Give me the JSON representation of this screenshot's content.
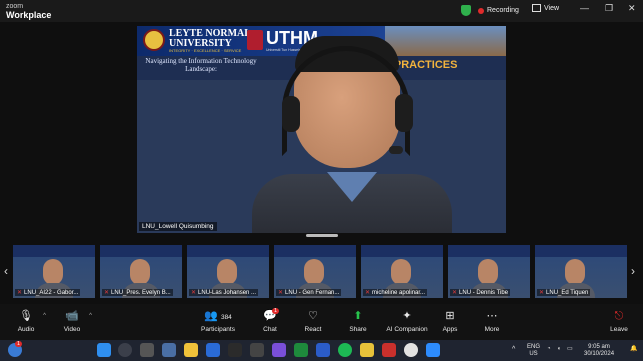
{
  "app": {
    "brand_top": "zoom",
    "brand_bottom": "Workplace"
  },
  "titlebar": {
    "recording_label": "Recording",
    "view_label": "View",
    "minimize": "—",
    "restore": "❐",
    "close": "✕"
  },
  "speaker": {
    "name": "LNU_Lowell Quisumbing",
    "banner": {
      "lnu_line1": "LEYTE NORMAL",
      "lnu_line2": "UNIVERSITY",
      "lnu_tagline": "INTEGRITY · EXCELLENCE · SERVICE",
      "uthm": "UTHM",
      "uthm_sub": "Universiti Tun Hussein Onn Malaysia",
      "title_left": "Navigating the Information Technology Landscape:",
      "title_right": "EMERG… AND PRACTICES"
    }
  },
  "participants_strip": [
    {
      "name": "LNU_AI22 - Gabor..."
    },
    {
      "name": "LNU_Pres. Evelyn B..."
    },
    {
      "name": "LNU-Las Johansen ..."
    },
    {
      "name": "LNU - Gen Fernan..."
    },
    {
      "name": "micheline apolinar..."
    },
    {
      "name": "LNU - Dennis Tibe"
    },
    {
      "name": "LNU_Ed Tiquen"
    }
  ],
  "toolbar": {
    "audio": "Audio",
    "video": "Video",
    "participants": "Participants",
    "participants_count": "384",
    "chat": "Chat",
    "chat_badge": "1",
    "react": "React",
    "share": "Share",
    "ai_companion": "AI Companion",
    "apps": "Apps",
    "more": "More",
    "leave": "Leave"
  },
  "taskbar": {
    "lang": "ENG",
    "region": "US",
    "time": "9:05 am",
    "date": "30/10/2024",
    "notif": "1"
  },
  "colors": {
    "accent": "#27c24c",
    "record": "#e02b2b",
    "banner_gold": "#f2b33d"
  }
}
